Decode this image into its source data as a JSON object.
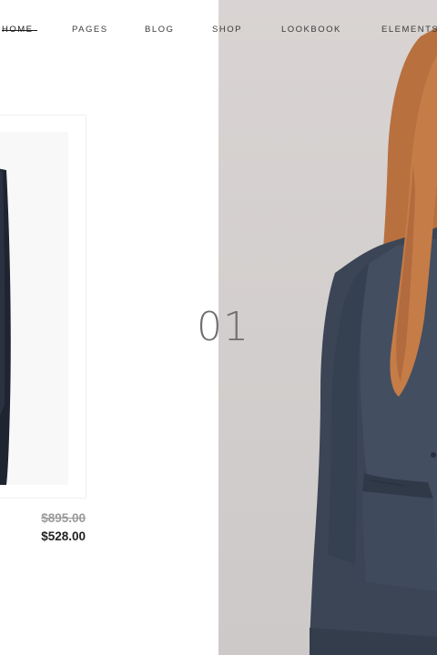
{
  "nav": {
    "items": [
      {
        "label": "HOME",
        "active": true
      },
      {
        "label": "PAGES"
      },
      {
        "label": "BLOG"
      },
      {
        "label": "SHOP"
      },
      {
        "label": "LOOKBOOK"
      },
      {
        "label": "ELEMENTS"
      }
    ]
  },
  "product": {
    "old_price": "$895.00",
    "new_price": "$528.00"
  },
  "slider": {
    "current": "01"
  },
  "colors": {
    "accent_text": "#222222",
    "muted_text": "#9a9a9a",
    "photo_background": "#d5d1d0",
    "jacket": "#3b4555"
  }
}
